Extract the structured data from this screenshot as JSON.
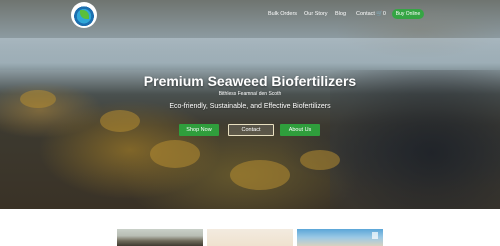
{
  "nav": {
    "links": [
      "Bulk Orders",
      "Our Story",
      "Blog",
      "Contact"
    ],
    "cart_count": "0",
    "cta": "Buy Online"
  },
  "hero": {
    "title": "Premium Seaweed Biofertilizers",
    "subtitle": "Bithless Feamnaí den Scoth",
    "tagline": "Eco-friendly, Sustainable, and Effective Biofertilizers",
    "buttons": [
      "Shop Now",
      "Contact",
      "About Us"
    ]
  },
  "icons": {
    "logo": "brand-logo-wave",
    "cart": "cart-icon"
  },
  "colors": {
    "accent": "#35a544"
  }
}
